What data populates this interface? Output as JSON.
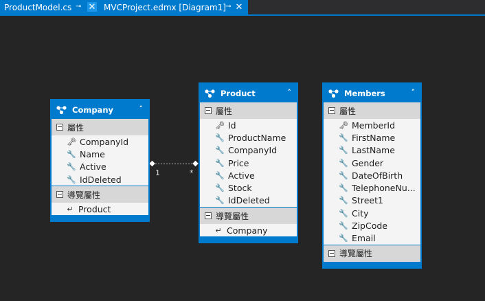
{
  "tabs": [
    {
      "label": "ProductModel.cs",
      "pin": "⊸",
      "close": "✕"
    },
    {
      "label": "MVCProject.edmx [Diagram1]",
      "pin": "⊸",
      "close": "✕"
    }
  ],
  "diagram": {
    "section_props": "屬性",
    "section_nav": "導覽屬性",
    "entities": {
      "company": {
        "title": "Company",
        "props": [
          "CompanyId",
          "Name",
          "Active",
          "IdDeleted"
        ],
        "nav": [
          "Product"
        ]
      },
      "product": {
        "title": "Product",
        "props": [
          "Id",
          "ProductName",
          "CompanyId",
          "Price",
          "Active",
          "Stock",
          "IdDeleted"
        ],
        "nav": [
          "Company"
        ]
      },
      "members": {
        "title": "Members",
        "props": [
          "MemberId",
          "FirstName",
          "LastName",
          "Gender",
          "DateOfBirth",
          "TelephoneNu...",
          "Street1",
          "City",
          "ZipCode",
          "Email"
        ],
        "nav": []
      }
    },
    "association": {
      "left_multiplicity": "1",
      "right_multiplicity": "*"
    }
  },
  "colors": {
    "accent": "#007acc",
    "canvas": "#252526"
  },
  "icons": {
    "key": "key-icon",
    "property": "wrench-icon",
    "nav": "navigation-property-icon",
    "entity": "entity-icon",
    "collapse": "chevron-up-icon"
  }
}
